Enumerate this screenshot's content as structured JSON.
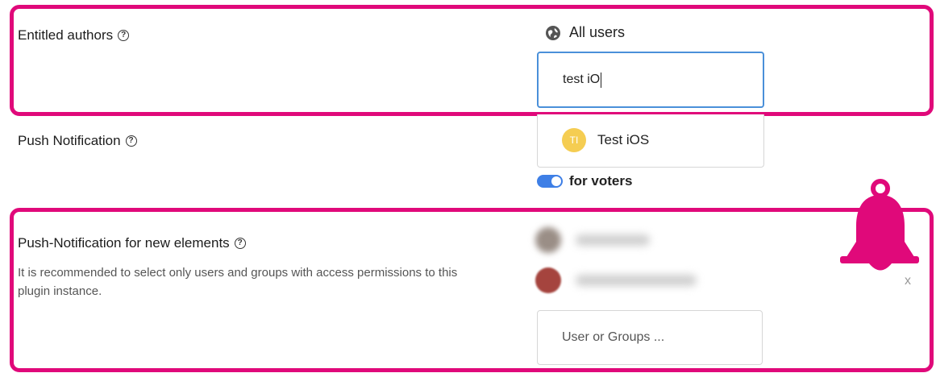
{
  "entitled_authors": {
    "label": "Entitled authors",
    "help": "?",
    "all_users_label": "All users",
    "search_value": "test iO",
    "suggestion": {
      "initials": "TI",
      "name": "Test iOS"
    }
  },
  "push_notification": {
    "label": "Push Notification",
    "help": "?",
    "toggle_label": "for voters",
    "toggle_on": true
  },
  "push_new_elements": {
    "label": "Push-Notification for new elements",
    "help": "?",
    "description": "It is recommended to select only users and groups with access permissions to this plugin instance.",
    "remove_label": "x",
    "input_placeholder": "User or Groups ..."
  },
  "colors": {
    "highlight": "#e0097a",
    "toggle": "#3e7fe6",
    "avatar_ti": "#f5cd52",
    "focus": "#4a90d9"
  },
  "icons": {
    "globe": "globe-icon",
    "bell": "bell-icon",
    "help": "help-circle-icon"
  }
}
